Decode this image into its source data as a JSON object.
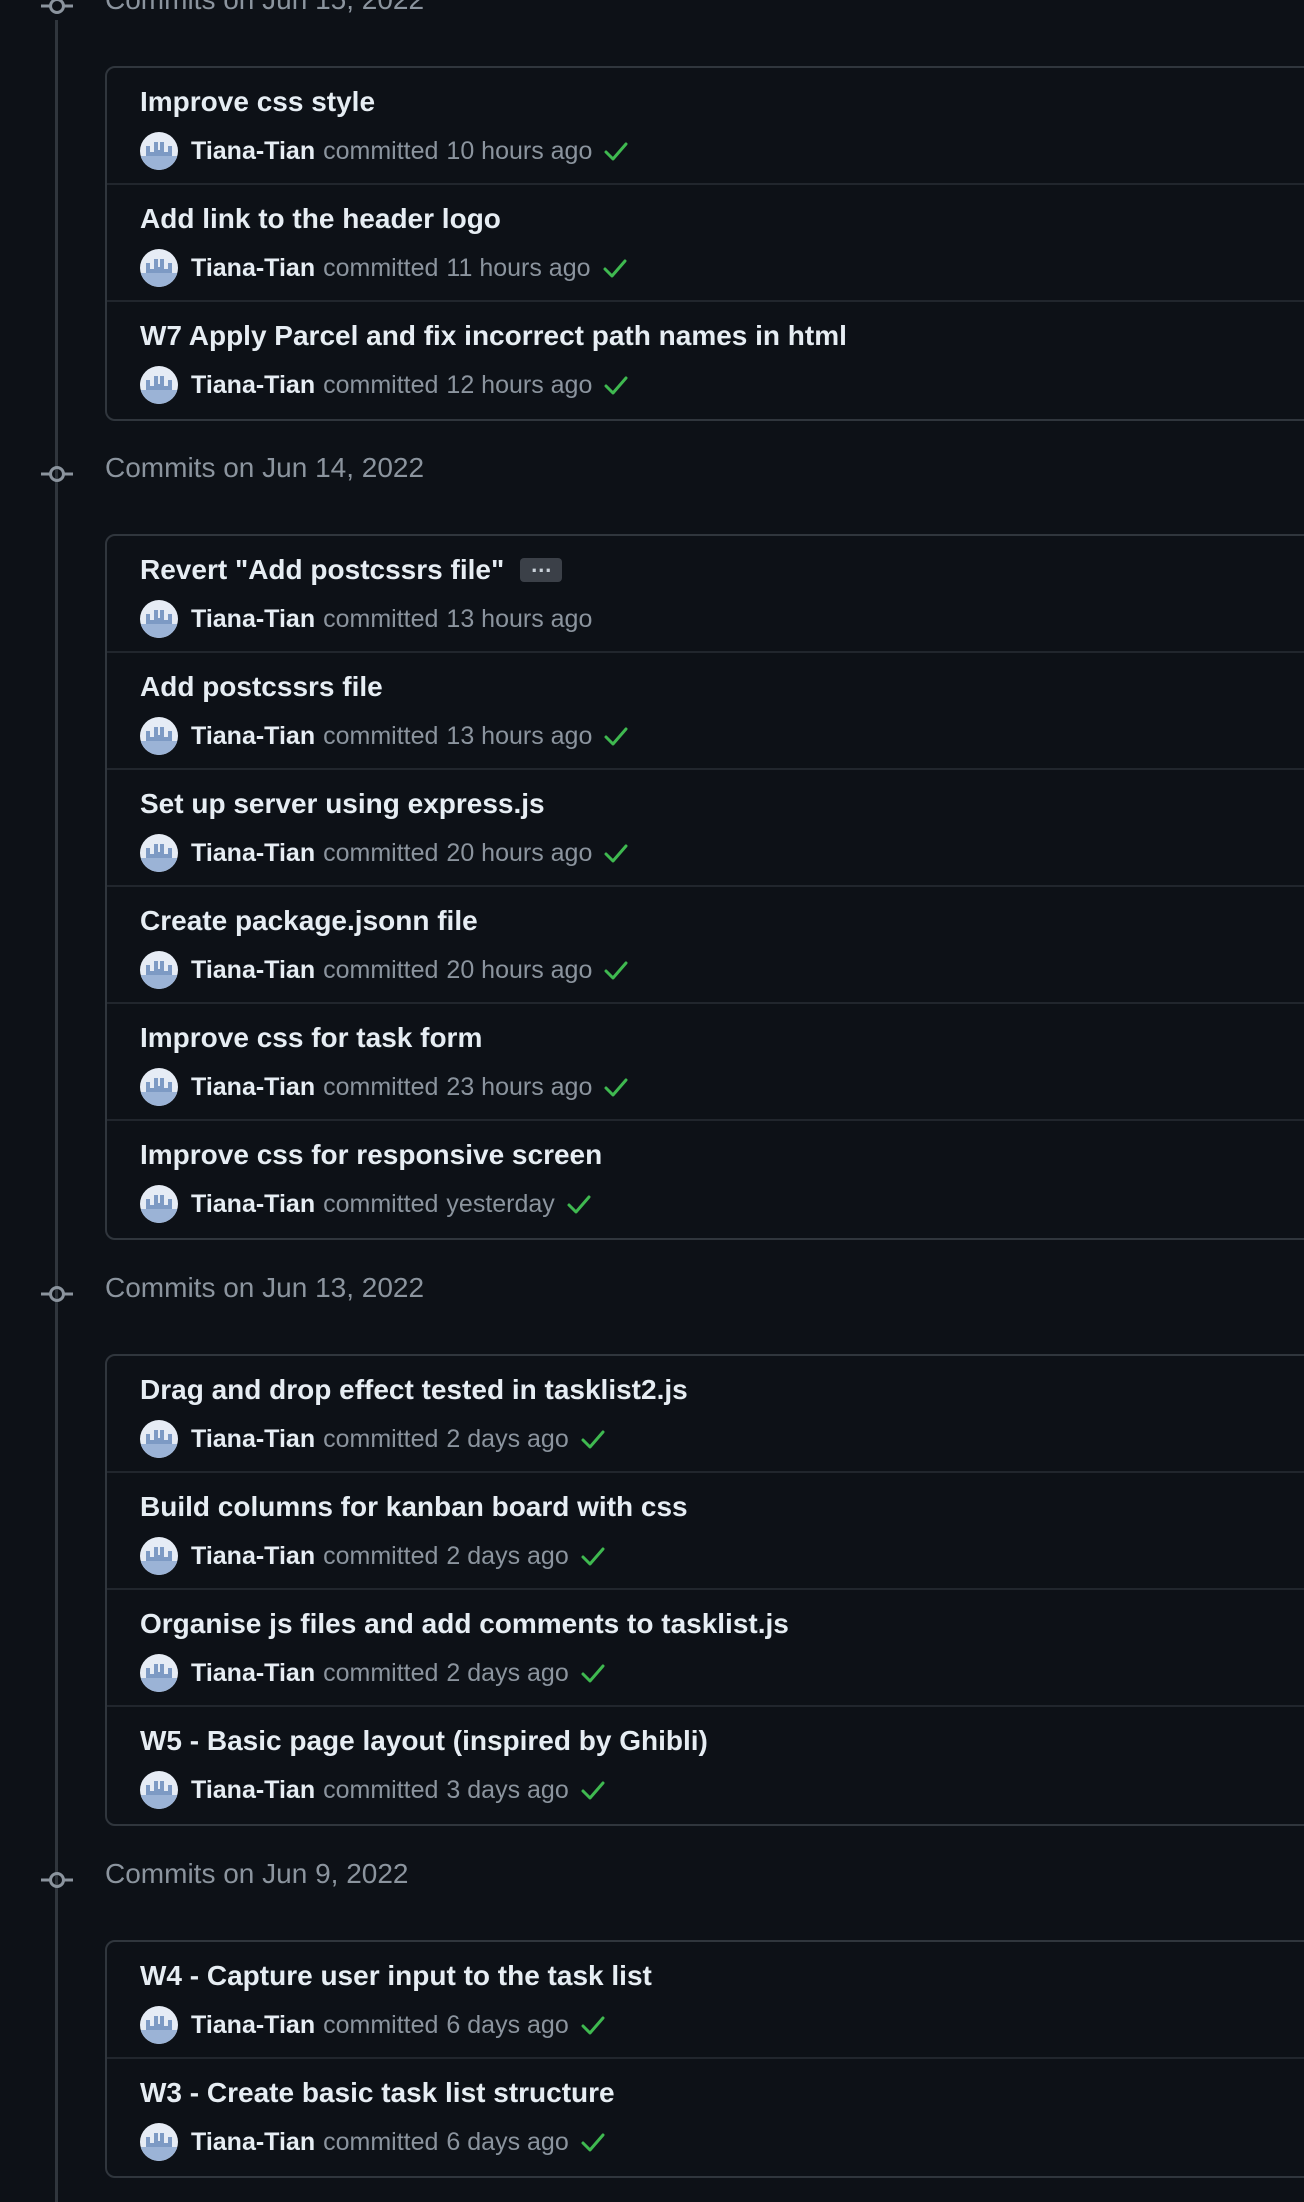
{
  "groups": [
    {
      "date_label": "Commits on Jun 15, 2022",
      "commits": [
        {
          "message": "Improve css style",
          "author": "Tiana-Tian",
          "verb": "committed",
          "time": "10 hours ago",
          "status": "success"
        },
        {
          "message": "Add link to the header logo",
          "author": "Tiana-Tian",
          "verb": "committed",
          "time": "11 hours ago",
          "status": "success"
        },
        {
          "message": "W7 Apply Parcel and fix incorrect path names in html",
          "author": "Tiana-Tian",
          "verb": "committed",
          "time": "12 hours ago",
          "status": "success"
        }
      ]
    },
    {
      "date_label": "Commits on Jun 14, 2022",
      "commits": [
        {
          "message": "Revert \"Add postcssrs file\"",
          "author": "Tiana-Tian",
          "verb": "committed",
          "time": "13 hours ago",
          "status": "none",
          "has_ellipsis": true
        },
        {
          "message": "Add postcssrs file",
          "author": "Tiana-Tian",
          "verb": "committed",
          "time": "13 hours ago",
          "status": "success"
        },
        {
          "message": "Set up server using express.js",
          "author": "Tiana-Tian",
          "verb": "committed",
          "time": "20 hours ago",
          "status": "success"
        },
        {
          "message": "Create package.jsonn file",
          "author": "Tiana-Tian",
          "verb": "committed",
          "time": "20 hours ago",
          "status": "success"
        },
        {
          "message": "Improve css for task form",
          "author": "Tiana-Tian",
          "verb": "committed",
          "time": "23 hours ago",
          "status": "success"
        },
        {
          "message": "Improve css for responsive screen",
          "author": "Tiana-Tian",
          "verb": "committed",
          "time": "yesterday",
          "status": "success"
        }
      ]
    },
    {
      "date_label": "Commits on Jun 13, 2022",
      "commits": [
        {
          "message": "Drag and drop effect tested in tasklist2.js",
          "author": "Tiana-Tian",
          "verb": "committed",
          "time": "2 days ago",
          "status": "success"
        },
        {
          "message": "Build columns for kanban board with css",
          "author": "Tiana-Tian",
          "verb": "committed",
          "time": "2 days ago",
          "status": "success"
        },
        {
          "message": "Organise js files and add comments to tasklist.js",
          "author": "Tiana-Tian",
          "verb": "committed",
          "time": "2 days ago",
          "status": "success"
        },
        {
          "message": "W5 - Basic page layout (inspired by Ghibli)",
          "author": "Tiana-Tian",
          "verb": "committed",
          "time": "3 days ago",
          "status": "success"
        }
      ]
    },
    {
      "date_label": "Commits on Jun 9, 2022",
      "commits": [
        {
          "message": "W4 - Capture user input to the task list",
          "author": "Tiana-Tian",
          "verb": "committed",
          "time": "6 days ago",
          "status": "success"
        },
        {
          "message": "W3 - Create basic task list structure",
          "author": "Tiana-Tian",
          "verb": "committed",
          "time": "6 days ago",
          "status": "success"
        }
      ]
    }
  ],
  "colors": {
    "background": "#0d1117",
    "border": "#30363d",
    "muted_text": "#8b949e",
    "primary_text": "#e6edf3",
    "success_check": "#3fb950"
  },
  "icons": {
    "group_marker": "git-commit-icon",
    "status_success": "check-icon",
    "avatar": "user-avatar"
  }
}
